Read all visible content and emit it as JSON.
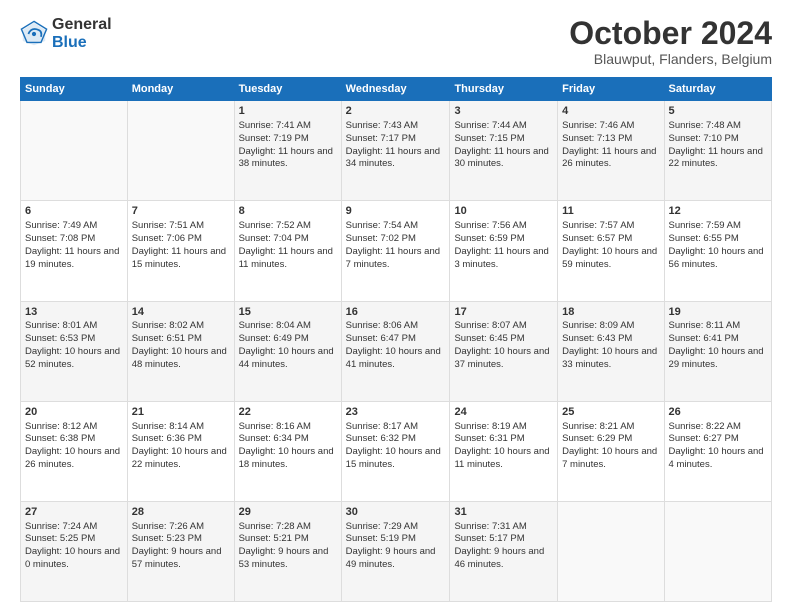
{
  "header": {
    "logo_general": "General",
    "logo_blue": "Blue",
    "month": "October 2024",
    "location": "Blauwput, Flanders, Belgium"
  },
  "days_of_week": [
    "Sunday",
    "Monday",
    "Tuesday",
    "Wednesday",
    "Thursday",
    "Friday",
    "Saturday"
  ],
  "weeks": [
    [
      {
        "day": "",
        "info": ""
      },
      {
        "day": "",
        "info": ""
      },
      {
        "day": "1",
        "info": "Sunrise: 7:41 AM\nSunset: 7:19 PM\nDaylight: 11 hours and 38 minutes."
      },
      {
        "day": "2",
        "info": "Sunrise: 7:43 AM\nSunset: 7:17 PM\nDaylight: 11 hours and 34 minutes."
      },
      {
        "day": "3",
        "info": "Sunrise: 7:44 AM\nSunset: 7:15 PM\nDaylight: 11 hours and 30 minutes."
      },
      {
        "day": "4",
        "info": "Sunrise: 7:46 AM\nSunset: 7:13 PM\nDaylight: 11 hours and 26 minutes."
      },
      {
        "day": "5",
        "info": "Sunrise: 7:48 AM\nSunset: 7:10 PM\nDaylight: 11 hours and 22 minutes."
      }
    ],
    [
      {
        "day": "6",
        "info": "Sunrise: 7:49 AM\nSunset: 7:08 PM\nDaylight: 11 hours and 19 minutes."
      },
      {
        "day": "7",
        "info": "Sunrise: 7:51 AM\nSunset: 7:06 PM\nDaylight: 11 hours and 15 minutes."
      },
      {
        "day": "8",
        "info": "Sunrise: 7:52 AM\nSunset: 7:04 PM\nDaylight: 11 hours and 11 minutes."
      },
      {
        "day": "9",
        "info": "Sunrise: 7:54 AM\nSunset: 7:02 PM\nDaylight: 11 hours and 7 minutes."
      },
      {
        "day": "10",
        "info": "Sunrise: 7:56 AM\nSunset: 6:59 PM\nDaylight: 11 hours and 3 minutes."
      },
      {
        "day": "11",
        "info": "Sunrise: 7:57 AM\nSunset: 6:57 PM\nDaylight: 10 hours and 59 minutes."
      },
      {
        "day": "12",
        "info": "Sunrise: 7:59 AM\nSunset: 6:55 PM\nDaylight: 10 hours and 56 minutes."
      }
    ],
    [
      {
        "day": "13",
        "info": "Sunrise: 8:01 AM\nSunset: 6:53 PM\nDaylight: 10 hours and 52 minutes."
      },
      {
        "day": "14",
        "info": "Sunrise: 8:02 AM\nSunset: 6:51 PM\nDaylight: 10 hours and 48 minutes."
      },
      {
        "day": "15",
        "info": "Sunrise: 8:04 AM\nSunset: 6:49 PM\nDaylight: 10 hours and 44 minutes."
      },
      {
        "day": "16",
        "info": "Sunrise: 8:06 AM\nSunset: 6:47 PM\nDaylight: 10 hours and 41 minutes."
      },
      {
        "day": "17",
        "info": "Sunrise: 8:07 AM\nSunset: 6:45 PM\nDaylight: 10 hours and 37 minutes."
      },
      {
        "day": "18",
        "info": "Sunrise: 8:09 AM\nSunset: 6:43 PM\nDaylight: 10 hours and 33 minutes."
      },
      {
        "day": "19",
        "info": "Sunrise: 8:11 AM\nSunset: 6:41 PM\nDaylight: 10 hours and 29 minutes."
      }
    ],
    [
      {
        "day": "20",
        "info": "Sunrise: 8:12 AM\nSunset: 6:38 PM\nDaylight: 10 hours and 26 minutes."
      },
      {
        "day": "21",
        "info": "Sunrise: 8:14 AM\nSunset: 6:36 PM\nDaylight: 10 hours and 22 minutes."
      },
      {
        "day": "22",
        "info": "Sunrise: 8:16 AM\nSunset: 6:34 PM\nDaylight: 10 hours and 18 minutes."
      },
      {
        "day": "23",
        "info": "Sunrise: 8:17 AM\nSunset: 6:32 PM\nDaylight: 10 hours and 15 minutes."
      },
      {
        "day": "24",
        "info": "Sunrise: 8:19 AM\nSunset: 6:31 PM\nDaylight: 10 hours and 11 minutes."
      },
      {
        "day": "25",
        "info": "Sunrise: 8:21 AM\nSunset: 6:29 PM\nDaylight: 10 hours and 7 minutes."
      },
      {
        "day": "26",
        "info": "Sunrise: 8:22 AM\nSunset: 6:27 PM\nDaylight: 10 hours and 4 minutes."
      }
    ],
    [
      {
        "day": "27",
        "info": "Sunrise: 7:24 AM\nSunset: 5:25 PM\nDaylight: 10 hours and 0 minutes."
      },
      {
        "day": "28",
        "info": "Sunrise: 7:26 AM\nSunset: 5:23 PM\nDaylight: 9 hours and 57 minutes."
      },
      {
        "day": "29",
        "info": "Sunrise: 7:28 AM\nSunset: 5:21 PM\nDaylight: 9 hours and 53 minutes."
      },
      {
        "day": "30",
        "info": "Sunrise: 7:29 AM\nSunset: 5:19 PM\nDaylight: 9 hours and 49 minutes."
      },
      {
        "day": "31",
        "info": "Sunrise: 7:31 AM\nSunset: 5:17 PM\nDaylight: 9 hours and 46 minutes."
      },
      {
        "day": "",
        "info": ""
      },
      {
        "day": "",
        "info": ""
      }
    ]
  ]
}
